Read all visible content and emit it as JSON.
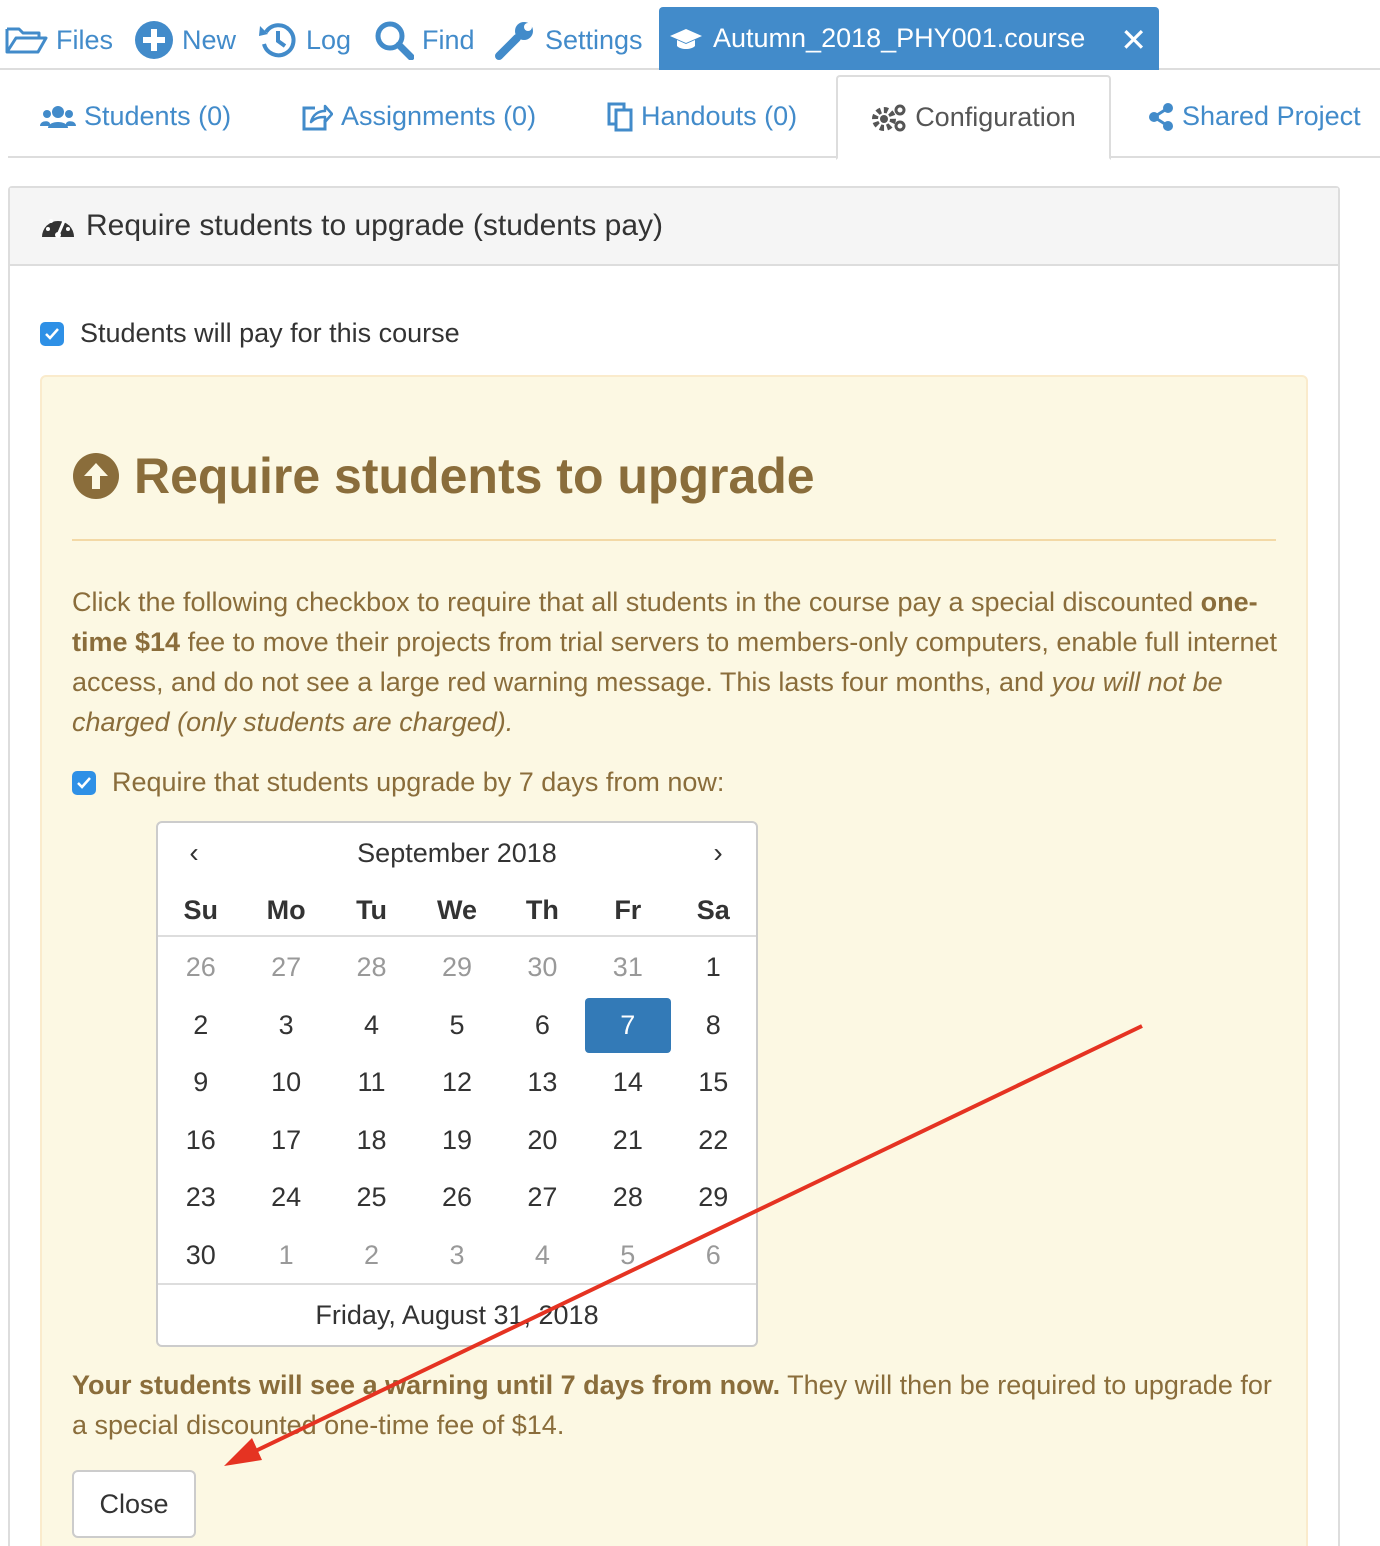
{
  "topnav": {
    "files": "Files",
    "new": "New",
    "log": "Log",
    "find": "Find",
    "settings": "Settings",
    "active_file": "Autumn_2018_PHY001.course"
  },
  "tabs": {
    "students": "Students (0)",
    "assignments": "Assignments (0)",
    "handouts": "Handouts (0)",
    "configuration": "Configuration",
    "shared_project": "Shared Project"
  },
  "panel": {
    "heading": "Require students to upgrade (students pay)",
    "pay_checkbox_label": "Students will pay for this course",
    "warning": {
      "title": "Require students to upgrade",
      "para_1": "Click the following checkbox to require that all students in the course pay a special discounted",
      "para_bold": "one-time $14",
      "para_2": "fee to move their projects from trial servers to members-only computers, enable full internet access, and do not see a large red warning message. This lasts four months, and",
      "para_italic": "you will not be charged (only students are charged).",
      "require_checkbox_label": "Require that students upgrade by 7 days from now:",
      "note_bold": "Your students will see a warning until 7 days from now.",
      "note_rest": "They will then be required to upgrade for a special discounted one-time fee of $14.",
      "close_button": "Close"
    }
  },
  "calendar": {
    "month_label": "September 2018",
    "prev": "‹",
    "next": "›",
    "weekdays": [
      "Su",
      "Mo",
      "Tu",
      "We",
      "Th",
      "Fr",
      "Sa"
    ],
    "weeks": [
      [
        {
          "d": "26",
          "m": true
        },
        {
          "d": "27",
          "m": true
        },
        {
          "d": "28",
          "m": true
        },
        {
          "d": "29",
          "m": true
        },
        {
          "d": "30",
          "m": true
        },
        {
          "d": "31",
          "m": true
        },
        {
          "d": "1"
        }
      ],
      [
        {
          "d": "2"
        },
        {
          "d": "3"
        },
        {
          "d": "4"
        },
        {
          "d": "5"
        },
        {
          "d": "6"
        },
        {
          "d": "7",
          "s": true
        },
        {
          "d": "8"
        }
      ],
      [
        {
          "d": "9"
        },
        {
          "d": "10"
        },
        {
          "d": "11"
        },
        {
          "d": "12"
        },
        {
          "d": "13"
        },
        {
          "d": "14"
        },
        {
          "d": "15"
        }
      ],
      [
        {
          "d": "16"
        },
        {
          "d": "17"
        },
        {
          "d": "18"
        },
        {
          "d": "19"
        },
        {
          "d": "20"
        },
        {
          "d": "21"
        },
        {
          "d": "22"
        }
      ],
      [
        {
          "d": "23"
        },
        {
          "d": "24"
        },
        {
          "d": "25"
        },
        {
          "d": "26"
        },
        {
          "d": "27"
        },
        {
          "d": "28"
        },
        {
          "d": "29"
        }
      ],
      [
        {
          "d": "30"
        },
        {
          "d": "1",
          "m": true
        },
        {
          "d": "2",
          "m": true
        },
        {
          "d": "3",
          "m": true
        },
        {
          "d": "4",
          "m": true
        },
        {
          "d": "5",
          "m": true
        },
        {
          "d": "6",
          "m": true
        }
      ]
    ],
    "footer_date": "Friday, August 31, 2018"
  },
  "colors": {
    "link_blue": "#428bca",
    "selected_day": "#337ab7",
    "warning_text": "#8a6d3b",
    "warning_bg": "#fcf8e3",
    "annotation_arrow": "#e53322"
  },
  "icons": {
    "files": "folder-open-icon",
    "new": "plus-circle-icon",
    "log": "history-icon",
    "find": "search-icon",
    "settings": "wrench-icon",
    "course": "graduation-cap-icon",
    "close": "close-icon",
    "students": "users-icon",
    "assignments": "share-square-icon",
    "handouts": "copy-icon",
    "configuration": "gears-icon",
    "shared": "share-alt-icon",
    "heading": "dashboard-icon",
    "upgrade": "arrow-circle-up-icon"
  }
}
